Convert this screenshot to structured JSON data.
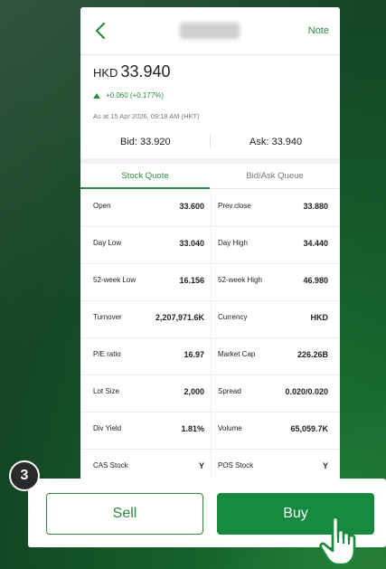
{
  "nav": {
    "note_label": "Note"
  },
  "quote": {
    "currency": "HKD",
    "price": "33.940",
    "change": "+0.060 (+0.177%)",
    "as_of": "As at 15 Apr 2026, 09:18 AM (HKT)",
    "bid": "Bid: 33.920",
    "ask": "Ask: 33.940"
  },
  "tabs": {
    "stock_quote": "Stock Quote",
    "bid_ask_queue": "Bid/Ask Queue"
  },
  "rows": [
    {
      "l_label": "Open",
      "l_value": "33.600",
      "r_label": "Prev.close",
      "r_value": "33.880"
    },
    {
      "l_label": "Day Low",
      "l_value": "33.040",
      "r_label": "Day High",
      "r_value": "34.440"
    },
    {
      "l_label": "52-week Low",
      "l_value": "16.156",
      "r_label": "52-week High",
      "r_value": "46.980"
    },
    {
      "l_label": "Turnover",
      "l_value": "2,207,971.6K",
      "r_label": "Currency",
      "r_value": "HKD"
    },
    {
      "l_label": "P/E ratio",
      "l_value": "16.97",
      "r_label": "Market Cap",
      "r_value": "226.26B"
    },
    {
      "l_label": "Lot Size",
      "l_value": "2,000",
      "r_label": "Spread",
      "r_value": "0.020/0.020"
    },
    {
      "l_label": "Div Yield",
      "l_value": "1.81%",
      "r_label": "Volume",
      "r_value": "65,059.7K"
    },
    {
      "l_label": "CAS Stock",
      "l_value": "Y",
      "r_label": "POS Stock",
      "r_value": "Y"
    }
  ],
  "actions": {
    "sell_label": "Sell",
    "buy_label": "Buy"
  },
  "step": {
    "number": "3"
  },
  "icons": {
    "back": "chevron-left-icon",
    "up": "triangle-up-icon",
    "cursor": "hand-pointer-icon"
  },
  "colors": {
    "accent": "#2e8b3c",
    "buy_bg": "#168a3f"
  }
}
